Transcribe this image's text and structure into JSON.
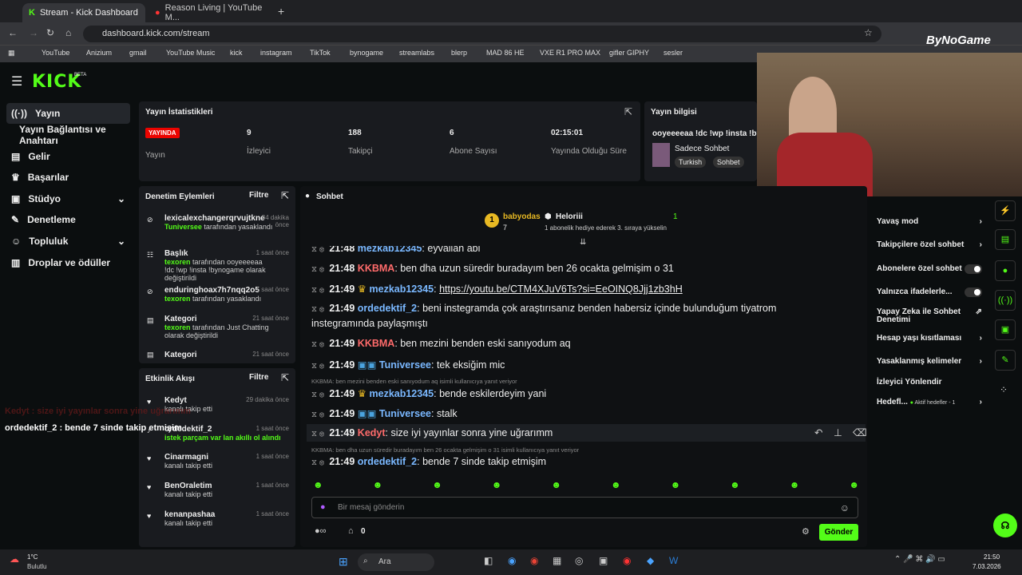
{
  "browser": {
    "tabs": [
      {
        "label": "Stream - Kick Dashboard"
      },
      {
        "label": "Reason Living | YouTube M..."
      }
    ],
    "url": "dashboard.kick.com/stream",
    "bookmarks": [
      "YouTube",
      "Anizium",
      "gmail",
      "YouTube Music",
      "kick",
      "instagram",
      "TikTok",
      "bynogame",
      "streamlabs",
      "blerp",
      "MAD 86 HE",
      "VXE R1 PRO MAX",
      "gifler GIPHY",
      "sesler"
    ]
  },
  "kick": {
    "logo": "KICK",
    "beta": "BETA"
  },
  "nav": {
    "items": [
      "Yayın",
      "Yayın Bağlantısı ve Anahtarı",
      "Gelir",
      "Başarılar",
      "Stüdyo",
      "Denetleme",
      "Topluluk",
      "Droplar ve ödüller"
    ]
  },
  "stats": {
    "title": "Yayın İstatistikleri",
    "live": "YAYINDA",
    "live_label": "Yayın",
    "viewers": "9",
    "viewers_label": "İzleyici",
    "followers": "188",
    "followers_label": "Takipçi",
    "subs": "6",
    "subs_label": "Abone Sayısı",
    "uptime": "02:15:01",
    "uptime_label": "Yayında Olduğu Süre"
  },
  "info": {
    "title": "Yayın bilgisi",
    "stream_title": "ooyeeeeaa !dc !wp !insta !byn...",
    "category": "Sadece Sohbet",
    "tags": [
      "Turkish",
      "Sohbet"
    ]
  },
  "mod": {
    "title": "Denetim Eylemleri",
    "filter": "Filtre",
    "items": [
      {
        "t": "lexicalexchangerqrvujtkne",
        "a": "Tuniversee",
        "s": "tarafından yasaklandı",
        "tm": "34 dakika önce"
      },
      {
        "t": "Başlık",
        "a": "texoren",
        "s": "tarafından ooyeeeeaa !dc !wp !insta !bynogame olarak değiştirildi",
        "tm": "1 saat önce"
      },
      {
        "t": "enduringhoax7h7nqq2o5",
        "a": "texoren",
        "s": "tarafından yasaklandı",
        "tm": "1 saat önce"
      },
      {
        "t": "Kategori",
        "a": "texoren",
        "s": "tarafından Just Chatting olarak değiştirildi",
        "tm": "21 saat önce"
      },
      {
        "t": "Kategori",
        "a": "",
        "s": "",
        "tm": "21 saat önce"
      }
    ]
  },
  "activity": {
    "title": "Etkinlik Akışı",
    "filter": "Filtre",
    "items": [
      {
        "t": "Kedyt",
        "s": "kanalı takip etti",
        "tm": "29 dakika önce"
      },
      {
        "t": "ordedektif_2",
        "s": "istek parçam var lan akıllı ol alındı",
        "tm": "1 saat önce"
      },
      {
        "t": "Cinarmagni",
        "s": "kanalı takip etti",
        "tm": "1 saat önce"
      },
      {
        "t": "BenOraletim",
        "s": "kanalı takip etti",
        "tm": "1 saat önce"
      },
      {
        "t": "kenanpashaa",
        "s": "kanalı takip etti",
        "tm": "1 saat önce"
      }
    ]
  },
  "chat": {
    "title": "Sohbet",
    "top": [
      {
        "name": "babyodas",
        "count": "7"
      },
      {
        "name": "Heloriii",
        "count": "1"
      }
    ],
    "sub_note": "1 abonelik hediye ederek 3. sıraya yükselin",
    "messages": [
      {
        "time": "21:48",
        "user": "mezkab12345",
        "color": "#7ab8ff",
        "text": "eyvallah abi"
      },
      {
        "time": "21:48",
        "user": "KKBMA",
        "color": "#ff6b6b",
        "text": "ben dha uzun süredir buradayım ben 26 ocakta gelmişim o 31"
      },
      {
        "time": "21:49",
        "user": "mezkab12345",
        "color": "#7ab8ff",
        "text": "https://youtu.be/CTM4XJuV6Ts?si=EeOINQ8Jjj1zb3hH"
      },
      {
        "time": "21:49",
        "user": "ordedektif_2",
        "color": "#7ab8ff",
        "text": "beni instegramda çok araştırısanız benden habersiz içinde bulunduğum tiyatrom"
      },
      {
        "time": "21:49",
        "user": "KKBMA",
        "color": "#ff6b6b",
        "text": "ben mezini benden eski sanıyodum aq"
      },
      {
        "time": "21:49",
        "user": "Tuniversee",
        "color": "#7ab8ff",
        "text": "tek eksiğim mic"
      },
      {
        "time": "21:49",
        "user": "mezkab12345",
        "color": "#7ab8ff",
        "text": "bende eskilerdeyim yani"
      },
      {
        "time": "21:49",
        "user": "Tuniversee",
        "color": "#7ab8ff",
        "text": "stalk"
      },
      {
        "time": "21:49",
        "user": "Kedyt",
        "color": "#ff6b6b",
        "text": "size iyi yayınlar sonra yine uğrarımm"
      },
      {
        "time": "21:49",
        "user": "ordedektif_2",
        "color": "#7ab8ff",
        "text": "bende 7 sinde takip etmişim"
      }
    ],
    "wrap": "instegramında paylaşmıştı",
    "reply1": "KKBMA: ben mezini benden eski sanıyodum aq isimli kullanıcıya yanıt veriyor",
    "reply2": "KKBMA: ben dha uzun süredir buradayım ben 26 ocakta gelmişim o 31 isimli kullanıcıya yanıt veriyor",
    "placeholder": "Bir mesaj gönderin",
    "send": "Gönder",
    "points": "0"
  },
  "right": {
    "items": [
      "Yavaş mod",
      "Takipçilere özel sohbet",
      "Abonelere özel sohbet",
      "Yalnızca ifadelerle...",
      "Yapay Zeka ile Sohbet Denetimi",
      "Hesap yaşı kısıtlaması",
      "Yasaklanmış kelimeler",
      "İzleyici Yönlendir",
      "Hedefl..."
    ],
    "goals": "Aktif hedefler - 1"
  },
  "overlay": {
    "l1": "Kedyt : size iyi yayınlar sonra yine uğrarımm",
    "l2": "ordedektif_2 : bende 7 sinde takip etmişim",
    "brand": "ByNoGame"
  },
  "taskbar": {
    "temp": "1°C",
    "weather": "Bulutlu",
    "search": "Ara",
    "time": "21:50",
    "date": "7.03.2026"
  }
}
